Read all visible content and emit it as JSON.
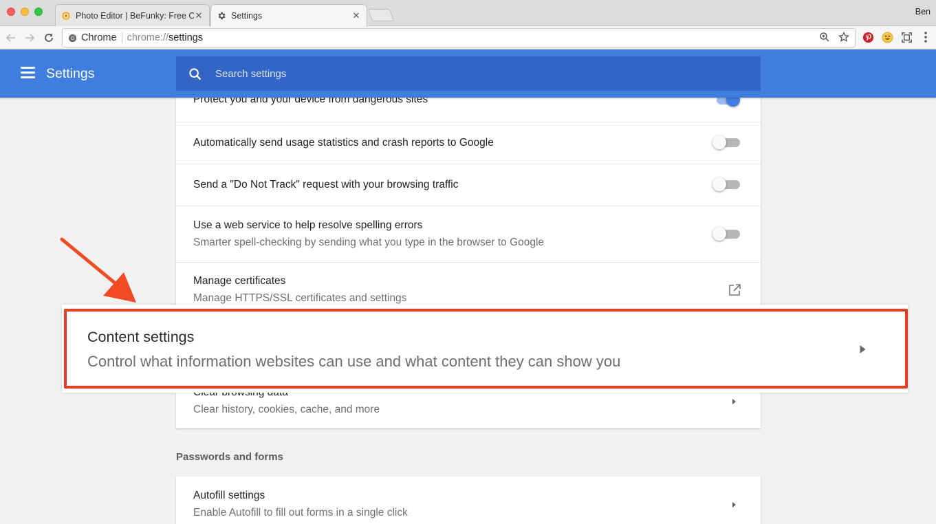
{
  "browser": {
    "tabs": [
      {
        "title": "Photo Editor | BeFunky: Free O",
        "active": false
      },
      {
        "title": "Settings",
        "active": true
      }
    ],
    "profile_name": "Ben",
    "address_bar": {
      "chip_label": "Chrome",
      "scheme": "chrome://",
      "host": "settings"
    },
    "tab_close_glyph": "✕"
  },
  "header": {
    "title": "Settings",
    "search_placeholder": "Search settings"
  },
  "privacy_rows": [
    {
      "primary": "Protect you and your device from dangerous sites",
      "control": "toggle",
      "on": true
    },
    {
      "primary": "Automatically send usage statistics and crash reports to Google",
      "control": "toggle",
      "on": false
    },
    {
      "primary": "Send a \"Do Not Track\" request with your browsing traffic",
      "control": "toggle",
      "on": false
    },
    {
      "primary": "Use a web service to help resolve spelling errors",
      "secondary": "Smarter spell-checking by sending what you type in the browser to Google",
      "control": "toggle",
      "on": false
    },
    {
      "primary": "Manage certificates",
      "secondary": "Manage HTTPS/SSL certificates and settings",
      "control": "external-link-icon"
    },
    {
      "primary": "Clear browsing data",
      "secondary": "Clear history, cookies, cache, and more",
      "control": "chevron-right-icon"
    }
  ],
  "callout": {
    "title": "Content settings",
    "description": "Control what information websites can use and what content they can show you"
  },
  "passwords_section": {
    "title": "Passwords and forms",
    "rows": [
      {
        "primary": "Autofill settings",
        "secondary": "Enable Autofill to fill out forms in a single click",
        "control": "chevron-right-icon"
      }
    ]
  },
  "colors": {
    "accent": "#3f7ede",
    "search_bg": "#3265c5",
    "highlight_red": "#ea3a1f",
    "page_bg": "#f1f1f1"
  }
}
